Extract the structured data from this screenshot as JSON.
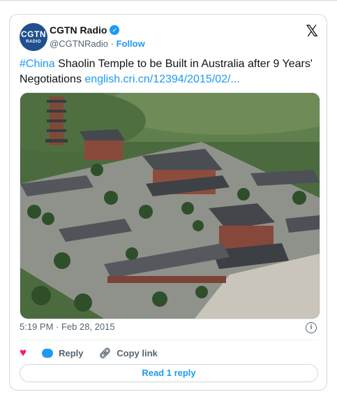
{
  "author": {
    "avatar_line1": "CGTN",
    "avatar_line2": "RADIO",
    "name": "CGTN Radio",
    "handle": "@CGTNRadio",
    "separator": " · ",
    "follow": "Follow"
  },
  "tweet": {
    "hashtag": "#China",
    "text": " Shaolin Temple to be Built in Australia after 9 Years' Negotiations ",
    "link": "english.cri.cn/12394/2015/02/..."
  },
  "meta": {
    "timestamp": "5:19 PM · Feb 28, 2015"
  },
  "actions": {
    "reply_label": "Reply",
    "copy_label": "Copy link",
    "read_replies": "Read 1 reply"
  },
  "colors": {
    "accent": "#1d9bf0",
    "heart": "#f91880"
  },
  "icons": [
    "verified-badge-icon",
    "x-logo-icon",
    "info-icon",
    "heart-icon",
    "reply-bubble-icon",
    "link-icon"
  ]
}
